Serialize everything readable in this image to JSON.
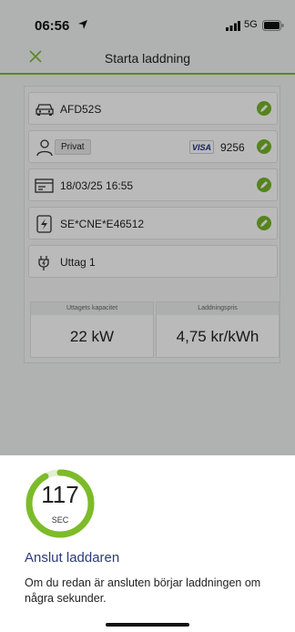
{
  "status_bar": {
    "time": "06:56",
    "network": "5G"
  },
  "nav": {
    "title": "Starta laddning"
  },
  "rows": {
    "vehicle": "AFD52S",
    "account_type": "Privat",
    "card_brand": "VISA",
    "card_last4": "9256",
    "datetime": "18/03/25 16:55",
    "charger_id": "SE*CNE*E46512",
    "outlet": "Uttag 1"
  },
  "info": {
    "capacity_label": "Uttagets kapacitet",
    "capacity_value": "22 kW",
    "price_label": "Laddningspris",
    "price_value": "4,75 kr/kWh"
  },
  "sheet": {
    "countdown_value": "117",
    "countdown_unit": "SEC",
    "countdown_progress": 0.92,
    "title": "Anslut laddaren",
    "body": "Om du redan är ansluten börjar laddningen om några sekunder."
  },
  "colors": {
    "accent_green": "#7dbb2a",
    "title_blue": "#2a3b7b"
  },
  "icons": [
    "location-arrow-icon",
    "signal-icon",
    "battery-icon",
    "close-icon",
    "car-icon",
    "person-icon",
    "calendar-icon",
    "charger-icon",
    "plug-icon",
    "pencil-icon"
  ]
}
